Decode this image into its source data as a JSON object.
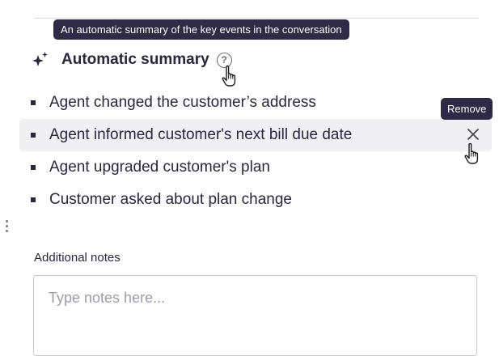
{
  "tooltip": {
    "summary_help": "An automatic summary of the key events in the conversation"
  },
  "summary": {
    "title": "Automatic summary",
    "icon": "sparkle-icon",
    "help_icon": "help-circle-icon",
    "items": [
      {
        "text": "Agent changed the customer’s address"
      },
      {
        "text": "Agent informed customer's next bill due date",
        "hovered": true
      },
      {
        "text": "Agent upgraded customer's plan"
      },
      {
        "text": "Customer asked about plan change"
      }
    ],
    "remove_tooltip": "Remove"
  },
  "notes": {
    "label": "Additional notes",
    "placeholder": "Type notes here...",
    "value": ""
  },
  "colors": {
    "text": "#2b2540",
    "tooltip_bg": "#2f2a45",
    "hover_bg": "#f0f0f3"
  }
}
